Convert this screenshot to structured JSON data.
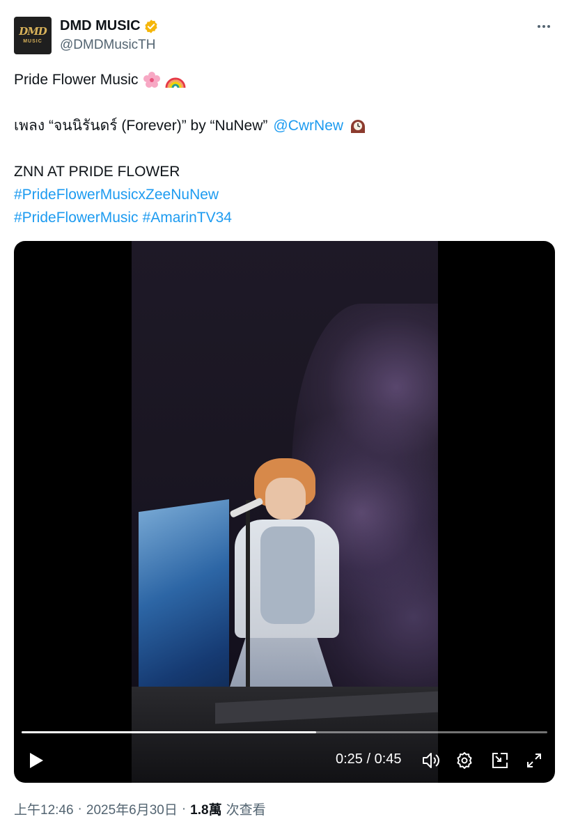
{
  "author": {
    "display_name": "DMD MUSIC",
    "handle": "@DMDMusicTH",
    "avatar_logo_top": "DMD",
    "avatar_logo_bottom": "MUSIC",
    "verified": true,
    "verified_color": "#f5b60a"
  },
  "tweet": {
    "line1_text": "Pride Flower Music",
    "line1_emojis": [
      "cherry-blossom-emoji",
      "rainbow-emoji"
    ],
    "line2_text": "เพลง “จนนิรันดร์ (Forever)” by “NuNew”",
    "line2_mention": "@CwrNew",
    "line2_emoji": "mantelpiece-clock-emoji",
    "line3_text": "ZNN AT PRIDE FLOWER",
    "hashtag1": "#PrideFlowerMusicxZeeNuNew",
    "hashtag2": "#PrideFlowerMusic",
    "hashtag3": "#AmarinTV34",
    "link_color": "#1d9bf0"
  },
  "video": {
    "current_time": "0:25",
    "duration": "0:45",
    "time_display": "0:25 / 0:45",
    "progress_fraction": 0.56,
    "controls": [
      "play-icon",
      "volume-icon",
      "settings-icon",
      "picture-in-picture-icon",
      "fullscreen-icon"
    ]
  },
  "meta": {
    "time": "上午12:46",
    "date": "2025年6月30日",
    "separator": "·",
    "views_count": "1.8萬",
    "views_label": "次查看"
  }
}
